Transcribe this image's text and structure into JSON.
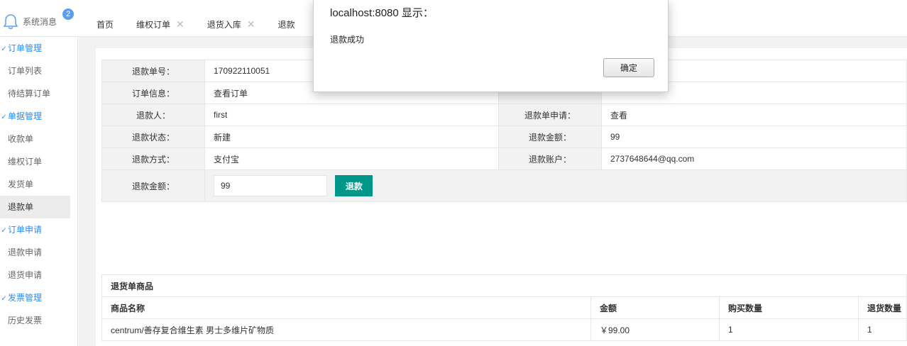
{
  "header": {
    "messages_label": "系统消息",
    "messages_badge": "2",
    "tabs": [
      {
        "label": "首页",
        "closable": false
      },
      {
        "label": "维权订单",
        "closable": true
      },
      {
        "label": "退货入库",
        "closable": true
      },
      {
        "label": "退款",
        "closable": false
      }
    ]
  },
  "sidebar": {
    "items": [
      {
        "label": "订单管理",
        "type": "group"
      },
      {
        "label": "订单列表",
        "type": "item"
      },
      {
        "label": "待结算订单",
        "type": "item"
      },
      {
        "label": "单据管理",
        "type": "group"
      },
      {
        "label": "收款单",
        "type": "item"
      },
      {
        "label": "维权订单",
        "type": "item"
      },
      {
        "label": "发货单",
        "type": "item"
      },
      {
        "label": "退款单",
        "type": "item",
        "active": true
      },
      {
        "label": "订单申请",
        "type": "group"
      },
      {
        "label": "退款申请",
        "type": "item"
      },
      {
        "label": "退货申请",
        "type": "item"
      },
      {
        "label": "发票管理",
        "type": "group"
      },
      {
        "label": "历史发票",
        "type": "item"
      }
    ]
  },
  "refund": {
    "no_label": "退款单号：",
    "no_value": "170922110051",
    "order_label": "订单信息：",
    "order_value": "查看订单",
    "person_label": "退款人：",
    "person_value": "first",
    "apply_label": "退款单申请：",
    "apply_value": "查看",
    "status_label": "退款状态：",
    "status_value": "新建",
    "amount_label": "退款金额：",
    "amount_value": "99",
    "method_label": "退款方式：",
    "method_value": "支付宝",
    "account_label": "退款账户：",
    "account_value": "2737648644@qq.com",
    "input_label": "退款金额：",
    "input_value": "99",
    "button_label": "退款"
  },
  "goods": {
    "title": "退货单商品",
    "columns": [
      "商品名称",
      "金额",
      "购买数量",
      "退货数量"
    ],
    "rows": [
      [
        "centrum/善存复合维生素 男士多维片矿物质",
        "￥99.00",
        "1",
        "1"
      ]
    ]
  },
  "dialog": {
    "title": "localhost:8080 显示：",
    "message": "退款成功",
    "ok_label": "确定"
  },
  "colors": {
    "accent": "#009688",
    "link_blue": "#2d8cf0",
    "badge": "#5b9df5"
  }
}
